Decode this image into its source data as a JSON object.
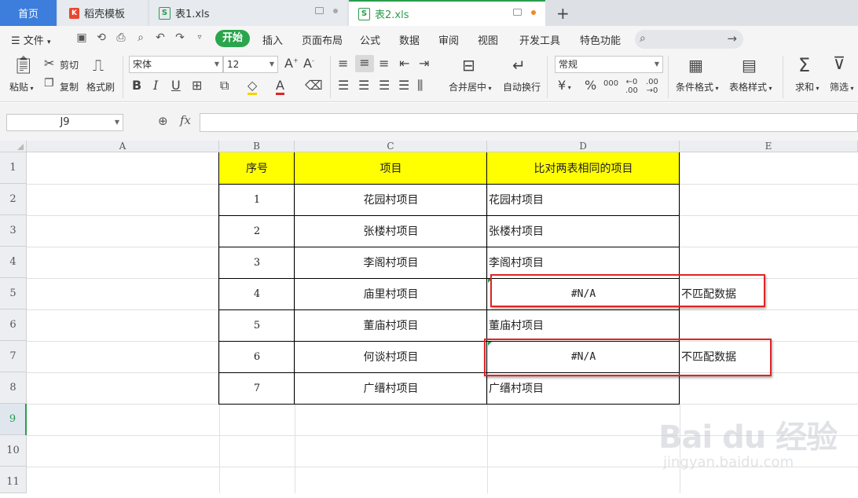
{
  "tabs": {
    "home": "首页",
    "daoke": "稻壳模板",
    "book1": "表1.xls",
    "book2": "表2.xls",
    "add": "+"
  },
  "menu": {
    "file": "文件",
    "items": [
      "开始",
      "插入",
      "页面布局",
      "公式",
      "数据",
      "审阅",
      "视图",
      "开发工具",
      "特色功能"
    ]
  },
  "ribbon": {
    "paste": "粘贴",
    "cut": "剪切",
    "copy": "复制",
    "format_painter": "格式刷",
    "font_name": "宋体",
    "font_size": "12",
    "bold": "B",
    "italic": "I",
    "underline": "U",
    "merge_center": "合并居中",
    "wrap_text": "自动换行",
    "number_format": "常规",
    "currency": "¥",
    "percent": "%",
    "thousands": "000",
    "cond_format": "条件格式",
    "table_style": "表格样式",
    "sum": "求和",
    "filter": "筛选"
  },
  "formula_bar": {
    "name_box": "J9",
    "fx": "fx",
    "formula": ""
  },
  "sheet": {
    "columns": [
      "A",
      "B",
      "C",
      "D",
      "E"
    ],
    "rows": [
      "1",
      "2",
      "3",
      "4",
      "5",
      "6",
      "7",
      "8",
      "9",
      "10",
      "11"
    ],
    "header": {
      "b": "序号",
      "c": "项目",
      "d": "比对两表相同的项目"
    },
    "data": [
      {
        "no": "1",
        "item": "花园村项目",
        "match": "花园村项目"
      },
      {
        "no": "2",
        "item": "张楼村项目",
        "match": "张楼村项目"
      },
      {
        "no": "3",
        "item": "李阁村项目",
        "match": "李阁村项目"
      },
      {
        "no": "4",
        "item": "庙里村项目",
        "match": "#N/A"
      },
      {
        "no": "5",
        "item": "董庙村项目",
        "match": "董庙村项目"
      },
      {
        "no": "6",
        "item": "何谈村项目",
        "match": "#N/A"
      },
      {
        "no": "7",
        "item": "广缙村项目",
        "match": "广缙村项目"
      }
    ],
    "notes": {
      "row5": "不匹配数据",
      "row7": "不匹配数据"
    },
    "active_row": "9"
  },
  "watermark": {
    "main": "Bai du 经验",
    "sub": "jingyan.baidu.com"
  },
  "colors": {
    "accent": "#2aa54b",
    "tab_home": "#3d7ddb",
    "header_fill": "#ffff00",
    "highlight": "#e02424"
  }
}
